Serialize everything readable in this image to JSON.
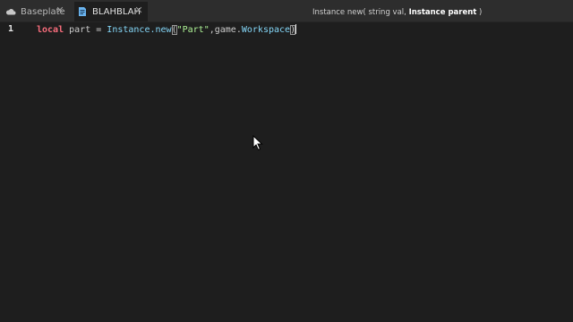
{
  "tabs": [
    {
      "label": "Baseplate",
      "icon": "cloud-icon",
      "close": "✕"
    },
    {
      "label": "BLAHBLAH",
      "icon": "script-icon",
      "close": "✕",
      "active": true
    }
  ],
  "signature_hint": {
    "prefix": "Instance new( string val, ",
    "param_bold": "Instance parent",
    "suffix": " )"
  },
  "editor": {
    "line_number": "1",
    "tokens": {
      "keyword": "local",
      "space1": " ",
      "variable": "part",
      "assign": " = ",
      "builtin_instance": "Instance",
      "dot_new": ".new",
      "open_paren": "(",
      "string": "\"Part\"",
      "comma": ",",
      "game": "game",
      "dot": ".",
      "workspace": "Workspace",
      "close_paren": ")"
    }
  },
  "colors": {
    "background": "#1e1e1e",
    "tabbar": "#2d2d2d",
    "keyword": "#f86d7c",
    "builtin": "#84d6f7",
    "string": "#adf195"
  }
}
